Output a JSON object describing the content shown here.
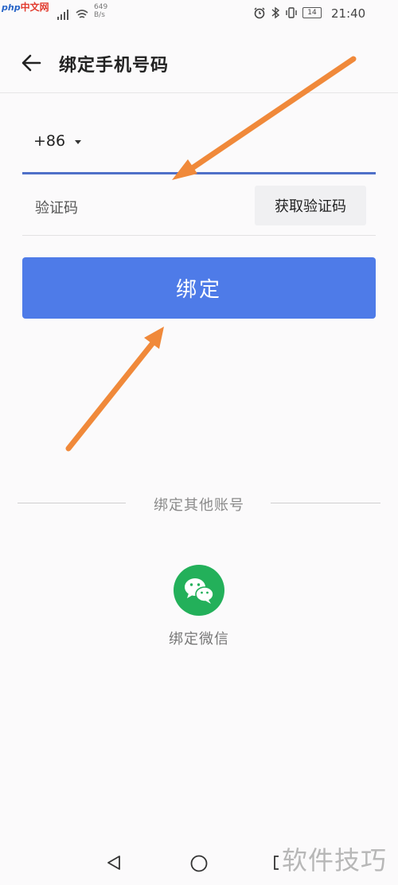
{
  "status_bar": {
    "watermark_php": "php",
    "watermark_cn": "中文网",
    "speed_value": "649",
    "speed_unit": "B/s",
    "time": "21:40",
    "battery": "14"
  },
  "header": {
    "title": "绑定手机号码"
  },
  "phone": {
    "country_code": "+86",
    "value": ""
  },
  "code": {
    "placeholder": "验证码",
    "get_code_label": "获取验证码"
  },
  "bind_label": "绑定",
  "other": {
    "label": "绑定其他账号",
    "wechat_label": "绑定微信"
  },
  "watermark_bottom": "软件技巧",
  "colors": {
    "accent": "#4e7be8",
    "underline": "#4f70c8",
    "wechat": "#23b05a",
    "arrow": "#f0893a"
  }
}
